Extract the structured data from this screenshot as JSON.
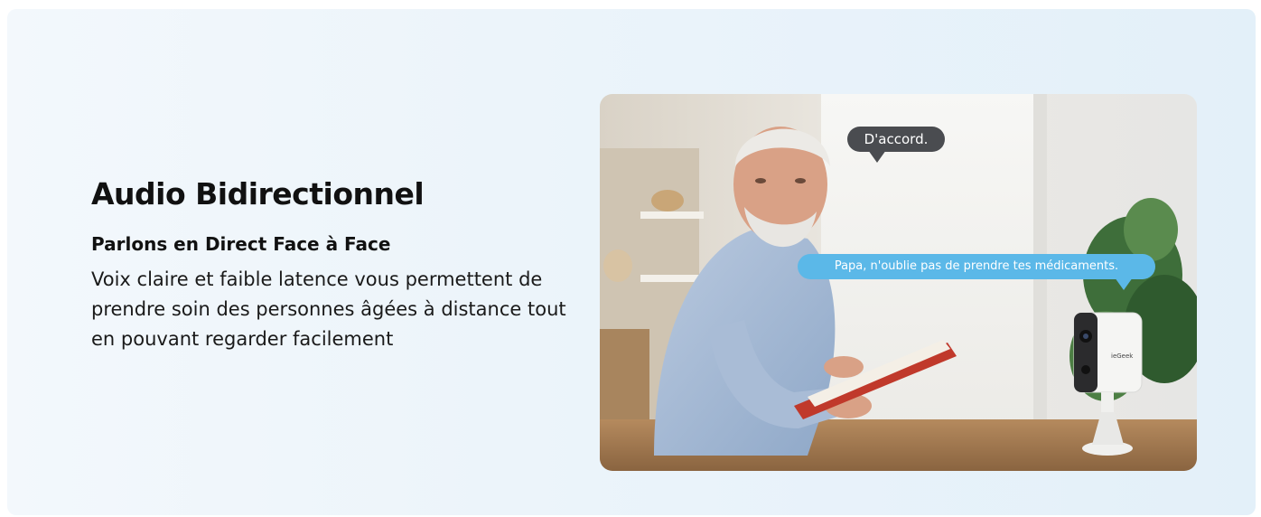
{
  "section": {
    "title": "Audio Bidirectionnel",
    "subtitle": "Parlons en Direct Face à Face",
    "description": "Voix claire et faible latence vous permettent de prendre soin des personnes âgées à distance tout en pouvant regarder facilement"
  },
  "photo": {
    "bubble_reply": "D'accord.",
    "bubble_message": "Papa, n'oublie pas de prendre tes médicaments.",
    "camera_brand": "ieGeek"
  },
  "colors": {
    "bubble_dark": "#4a4c50",
    "bubble_blue": "#5bb8e8",
    "title_text": "#111111"
  }
}
